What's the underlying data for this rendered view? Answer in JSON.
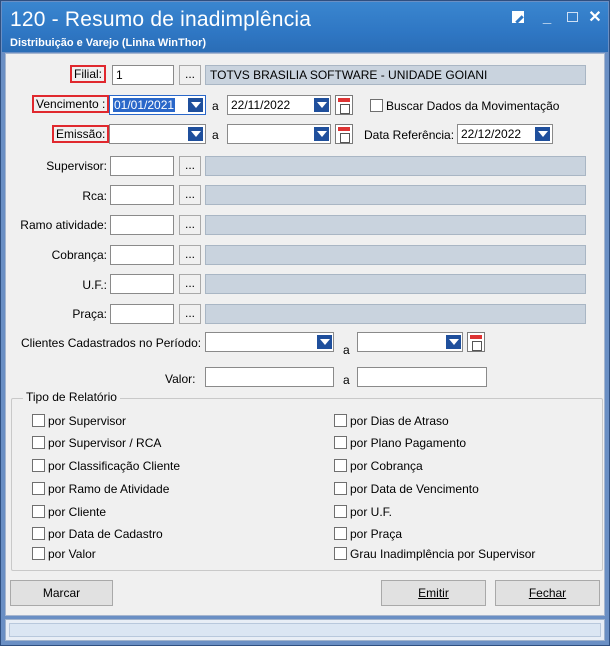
{
  "window": {
    "title": "120 - Resumo de inadimplência",
    "subtitle": "Distribuição e Varejo (Linha WinThor)"
  },
  "filters": {
    "filial_label": "Filial:",
    "filial_value": "1",
    "filial_name": "TOTVS BRASILIA SOFTWARE - UNIDADE GOIANI",
    "vencimento_label": "Vencimento :",
    "vencimento_from": "01/01/2021",
    "vencimento_to": "22/11/2022",
    "a_label": "a",
    "buscar_label": "Buscar Dados da Movimentação",
    "emissao_label": "Emissão:",
    "emissao_from": "",
    "emissao_to": "",
    "data_ref_label": "Data Referência:",
    "data_ref_value": "22/12/2022",
    "supervisor_label": "Supervisor:",
    "rca_label": "Rca:",
    "ramo_label": "Ramo atividade:",
    "cobranca_label": "Cobrança:",
    "uf_label": "U.F.:",
    "praca_label": "Praça:",
    "clientes_label": "Clientes Cadastrados no Período:",
    "valor_label": "Valor:",
    "dots": "..."
  },
  "tipo_relatorio": {
    "title": "Tipo de Relatório",
    "left": [
      "por Supervisor",
      "por Supervisor / RCA",
      "por Classificação Cliente",
      "por Ramo de Atividade",
      "por Cliente",
      "por Data de Cadastro",
      "por Valor"
    ],
    "right": [
      "por Dias de Atraso",
      "por Plano Pagamento",
      "por Cobrança",
      "por Data de Vencimento",
      "por U.F.",
      "por Praça",
      "Grau Inadimplência por Supervisor"
    ]
  },
  "buttons": {
    "marcar": "Marcar",
    "emitir": "Emitir",
    "fechar": "Fechar"
  },
  "colors": {
    "titlebar": "#2f77c4",
    "highlight_red": "#e0282e",
    "selection_blue": "#2a67c9"
  }
}
